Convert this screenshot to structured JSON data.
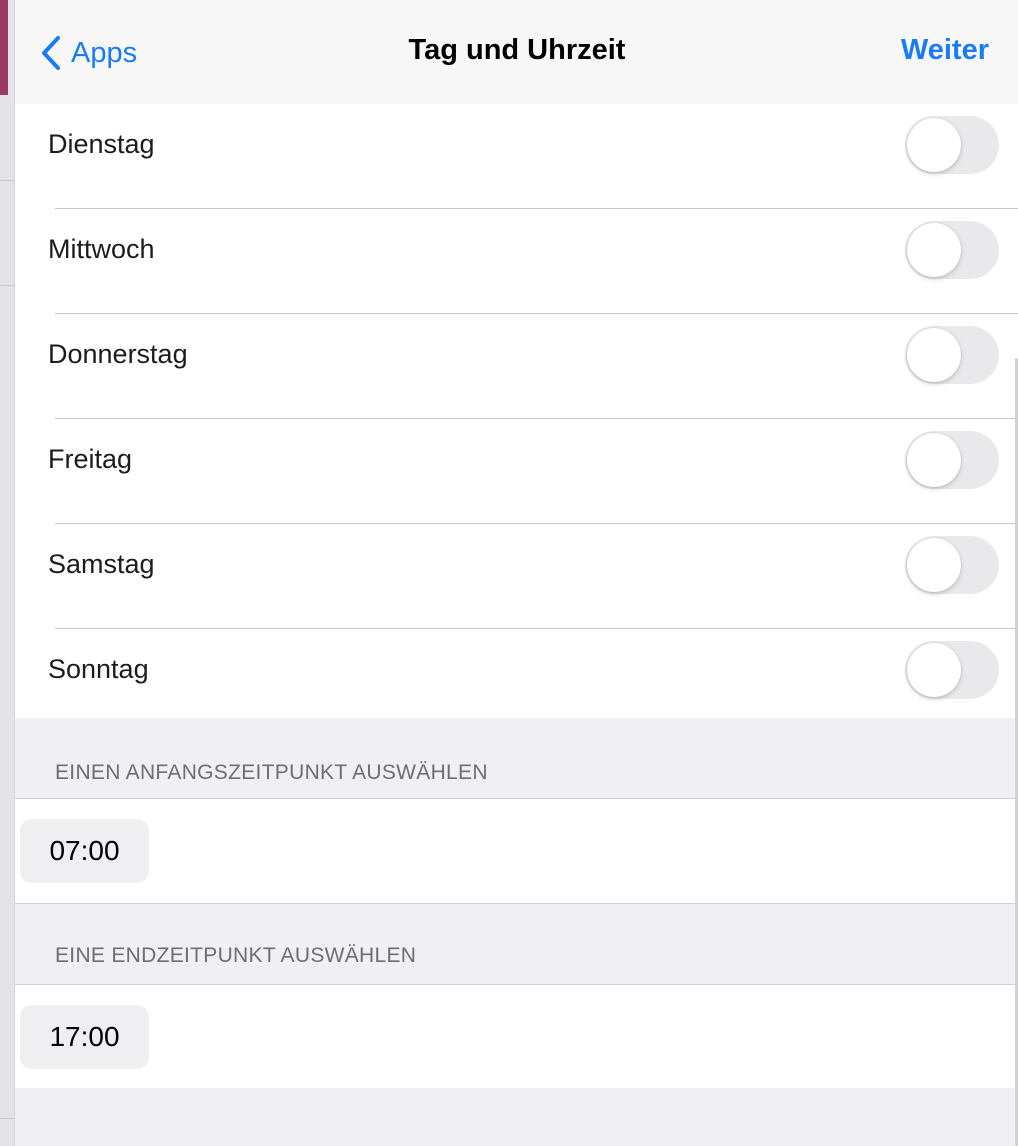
{
  "nav": {
    "back_label": "Apps",
    "title": "Tag und Uhrzeit",
    "next_label": "Weiter"
  },
  "days": [
    {
      "label": "Dienstag",
      "enabled": false
    },
    {
      "label": "Mittwoch",
      "enabled": false
    },
    {
      "label": "Donnerstag",
      "enabled": false
    },
    {
      "label": "Freitag",
      "enabled": false
    },
    {
      "label": "Samstag",
      "enabled": false
    },
    {
      "label": "Sonntag",
      "enabled": false
    }
  ],
  "start_section": {
    "header": "EINEN ANFANGSZEITPUNKT AUSWÄHLEN",
    "time": "07:00"
  },
  "end_section": {
    "header": "EINE ENDZEITPUNKT AUSWÄHLEN",
    "time": "17:00"
  },
  "colors": {
    "accent": "#1a7cf5",
    "toggle_off": "#e9e9eb",
    "grouped_background": "#efeff4"
  },
  "icons": {
    "back": "chevron-left-icon"
  }
}
